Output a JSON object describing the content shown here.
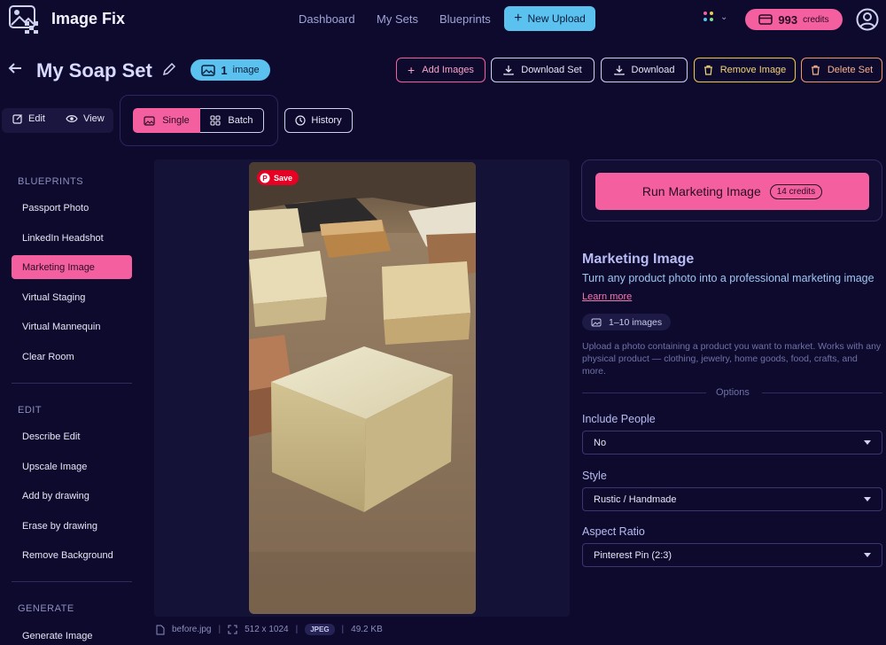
{
  "app": {
    "name": "Image Fix"
  },
  "nav": {
    "links": [
      "Dashboard",
      "My Sets",
      "Blueprints"
    ],
    "new_upload": "New Upload",
    "credits": {
      "count": "993",
      "label": "credits"
    }
  },
  "header": {
    "title": "My Soap Set",
    "image_count": "1",
    "image_count_label": "image",
    "buttons": {
      "add_images": "Add Images",
      "download_set": "Download Set",
      "download": "Download",
      "remove_image": "Remove Image",
      "delete_set": "Delete Set"
    }
  },
  "modes": {
    "edit": "Edit",
    "view": "View",
    "single": "Single",
    "batch": "Batch",
    "history": "History"
  },
  "sidebar": {
    "blueprints_heading": "BLUEPRINTS",
    "blueprints": [
      "Passport Photo",
      "LinkedIn Headshot",
      "Marketing Image",
      "Virtual Staging",
      "Virtual Mannequin",
      "Clear Room"
    ],
    "active": "Marketing Image",
    "edit_heading": "EDIT",
    "edit_items": [
      "Describe Edit",
      "Upscale Image",
      "Add by drawing",
      "Erase by drawing",
      "Remove Background"
    ],
    "generate_heading": "GENERATE",
    "generate_items": [
      "Generate Image"
    ]
  },
  "image": {
    "save_label": "Save",
    "filename": "before.jpg",
    "dimensions": "512 x 1024",
    "format": "JPEG",
    "size": "49.2 KB"
  },
  "run": {
    "label": "Run Marketing Image",
    "credits": "14 credits"
  },
  "blueprint": {
    "title": "Marketing Image",
    "subtitle": "Turn any product photo into a professional marketing image",
    "learn_more": "Learn more",
    "images_range": "1–10 images",
    "description": "Upload a photo containing a product you want to market. Works with any physical product — clothing, jewelry, home goods, food, crafts, and more.",
    "options_label": "Options",
    "fields": [
      {
        "label": "Include People",
        "value": "No"
      },
      {
        "label": "Style",
        "value": "Rustic / Handmade"
      },
      {
        "label": "Aspect Ratio",
        "value": "Pinterest Pin (2:3)"
      }
    ]
  },
  "colors": {
    "background": "#0e0a2e",
    "accent_pink": "#f45fa0",
    "accent_blue": "#5bc2f0"
  }
}
